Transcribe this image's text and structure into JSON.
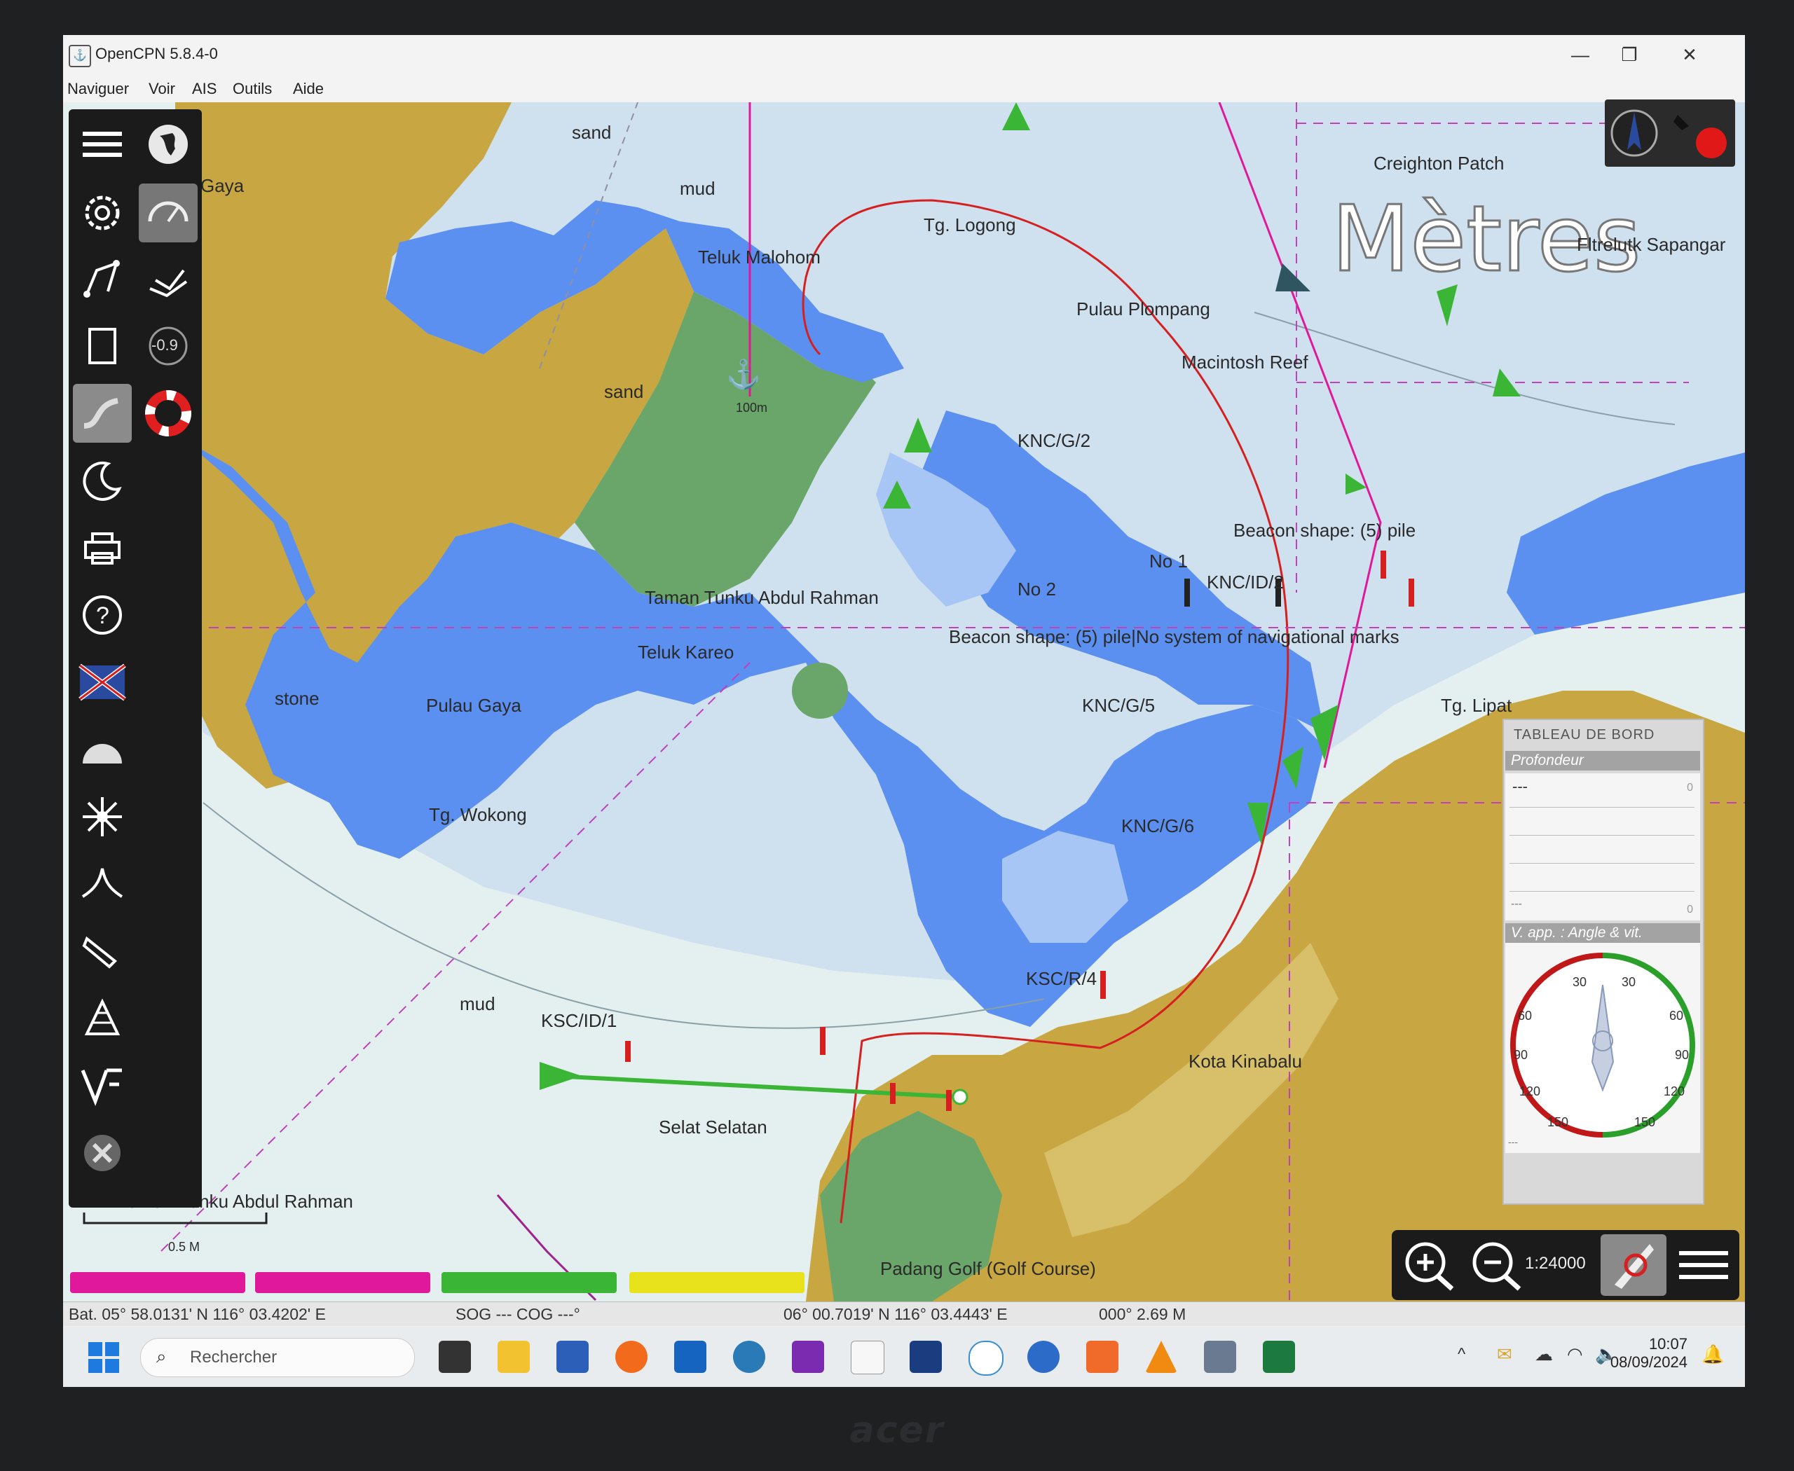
{
  "app": {
    "title": "OpenCPN 5.8.4-0",
    "window_controls": [
      "—",
      "❐",
      "✕"
    ]
  },
  "menu": [
    "Naviguer",
    "Voir",
    "AIS",
    "Outils",
    "Aide"
  ],
  "toolbar": {
    "left_items": [
      "menu-icon",
      "settings-icon",
      "route-icon",
      "files-icon",
      "track-icon",
      "night-mode-icon",
      "print-icon",
      "help-icon",
      "flag-icon",
      "dashboard-icon",
      "plugin-icon",
      "curve-icon",
      "arrow-icon",
      "radar-icon",
      "vf-icon",
      "logo-icon"
    ],
    "right_items": [
      "globe-icon",
      "gauge-icon",
      "waypoints-icon",
      "tide-icon",
      "lifebuoy-icon"
    ],
    "tide_value": "-0.9"
  },
  "chart": {
    "watermark": "Mètres",
    "place_labels": [
      "Gaya",
      "sand",
      "mud",
      "Teluk Malohom",
      "Tg. Logong",
      "Creighton Patch",
      "Pulau Plompang",
      "Macintosh Reef",
      "Fltrelutk Sapangar",
      "KNC/G/2",
      "Beacon shape: (5) pile",
      "No 1",
      "KNC/ID/2",
      "No 2",
      "Taman Tunku Abdul Rahman",
      "Beacon shape: (5) pile|No system of navigational marks",
      "Teluk Kareo",
      "stone",
      "Pulau Gaya",
      "KNC/G/5",
      "Tg. Lipat",
      "Tg. Wokong",
      "KNC/G/6",
      "KSC/R/4",
      "mud",
      "KSC/ID/1",
      "Kota Kinabalu",
      "Selat Selatan",
      "Padang Golf (Golf Course)",
      "Taman Tunku Abdul Rahman",
      "100m",
      "sand"
    ],
    "scale_bar_label": "0.5 M"
  },
  "compass_widget": {
    "icons": [
      "north-up-compass-icon",
      "pin-icon",
      "record-icon"
    ]
  },
  "dashboard": {
    "title": "TABLEAU DE BORD",
    "depth_section": "Profondeur",
    "depth_value": "---",
    "depth_scale_top": "0",
    "depth_scale_bottom": "0",
    "depth_bottom_value": "---",
    "wind_section": "V. app. : Angle & vit.",
    "wind_labels": [
      "30",
      "30",
      "60",
      "60",
      "90",
      "90",
      "120",
      "120",
      "150",
      "150"
    ],
    "wind_bottom_value": "---"
  },
  "zoom": {
    "scale": "1:24000"
  },
  "route_bars": [
    {
      "color": "#e0189a"
    },
    {
      "color": "#e0189a"
    },
    {
      "color": "#3bb536"
    },
    {
      "color": "#e8e21c"
    }
  ],
  "status": {
    "position": "Bat. 05° 58.0131' N   116° 03.4202' E",
    "sog_cog": "SOG --- COG ---°",
    "cursor": "06° 00.7019' N   116° 03.4443' E",
    "bearing": "000°  2.69 M"
  },
  "taskbar": {
    "search_placeholder": "Rechercher",
    "time": "10:07",
    "date": "08/09/2024",
    "apps": [
      "terminal-icon",
      "folder-icon",
      "powershell-icon",
      "firefox-icon",
      "outlook-icon",
      "globe-app-icon",
      "onenote-icon",
      "opencpn-icon",
      "pro-ais-icon",
      "navigation-app-icon",
      "m-app-icon",
      "orange-app-icon",
      "vlc-icon",
      "calculator-icon",
      "excel-icon"
    ]
  },
  "brand": "acer",
  "colors": {
    "land": "#c8a742",
    "shallow": "#5b8ff0",
    "medium": "#a7c5f5",
    "deep": "#e4efef",
    "intertidal": "#6aa56a",
    "route": "#e0189a",
    "active_route": "#3bb536",
    "boundary": "#d62020"
  }
}
